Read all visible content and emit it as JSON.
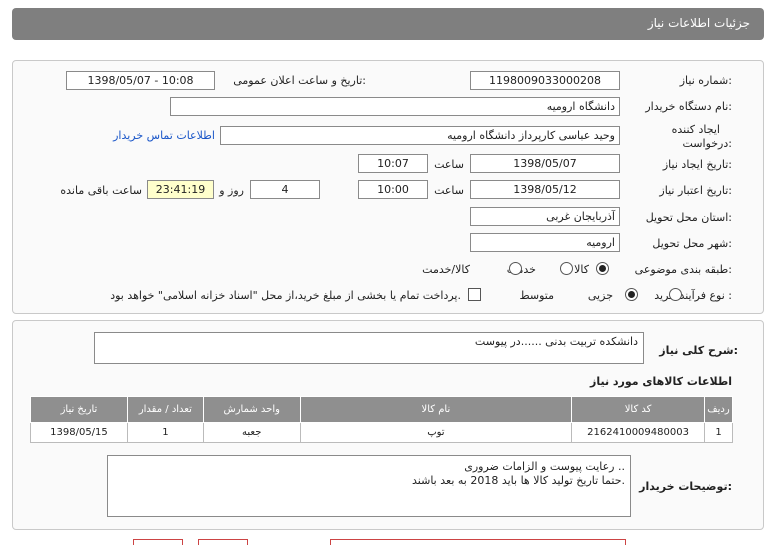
{
  "header": {
    "title": "جزئیات اطلاعات نیاز"
  },
  "form": {
    "need_number_label": "شماره نیاز:",
    "need_number": "1198009033000208",
    "announce_label": "تاریخ و ساعت اعلان عمومی:",
    "announce_value": "1398/05/07 - 10:08",
    "buyer_org_label": "نام دستگاه خریدار:",
    "buyer_org": "دانشگاه ارومیه",
    "creator_label_line1": "ایجاد کننده",
    "creator_label_line2": "درخواست:",
    "creator": "وحید عباسی کارپرداز دانشگاه ارومیه",
    "contact_link": "اطلاعات تماس خریدار",
    "created_date_label": "تاریخ ایجاد نیاز:",
    "created_date": "1398/05/07",
    "hour_label": "ساعت",
    "created_time": "10:07",
    "validity_label": "تاریخ اعتبار نیاز:",
    "validity_date": "1398/05/12",
    "validity_time": "10:00",
    "days_value": "4",
    "days_label": "روز و",
    "remaining_time": "23:41:19",
    "remaining_label": "ساعت باقی مانده",
    "province_label": "استان محل تحویل:",
    "province": "آذربایجان غربی",
    "city_label": "شهر محل تحویل:",
    "city": "ارومیه",
    "category_label": "طبقه بندی موضوعی:",
    "category_options": [
      "کالا",
      "خدمت",
      "کالا/خدمت"
    ],
    "category_selected": 0,
    "process_label": "نوع فرآیند خرید :",
    "process_options": [
      "جزیی",
      "متوسط"
    ],
    "process_selected": 1,
    "payment_text": "پرداخت تمام یا بخشی از مبلغ خرید،از محل \"اسناد خزانه اسلامی\" خواهد بود."
  },
  "summary": {
    "label": "شرح کلی نیاز:",
    "text": "دانشکده تربیت بدنی ......در پیوست"
  },
  "goods": {
    "title": "اطلاعات کالاهای مورد نیاز",
    "headers": [
      "ردیف",
      "کد کالا",
      "نام کالا",
      "واحد شمارش",
      "تعداد / مقدار",
      "تاریخ نیاز"
    ],
    "rows": [
      [
        "1",
        "2162410009480003",
        "توپ",
        "جعبه",
        "1",
        "1398/05/15"
      ]
    ]
  },
  "buyer_notes": {
    "label": "توضیحات خریدار:",
    "line1": "رعایت پیوست و الزامات ضروری ..",
    "line2": "حتما تاریخ تولید کالا ها باید 2018 به بعد باشند."
  }
}
